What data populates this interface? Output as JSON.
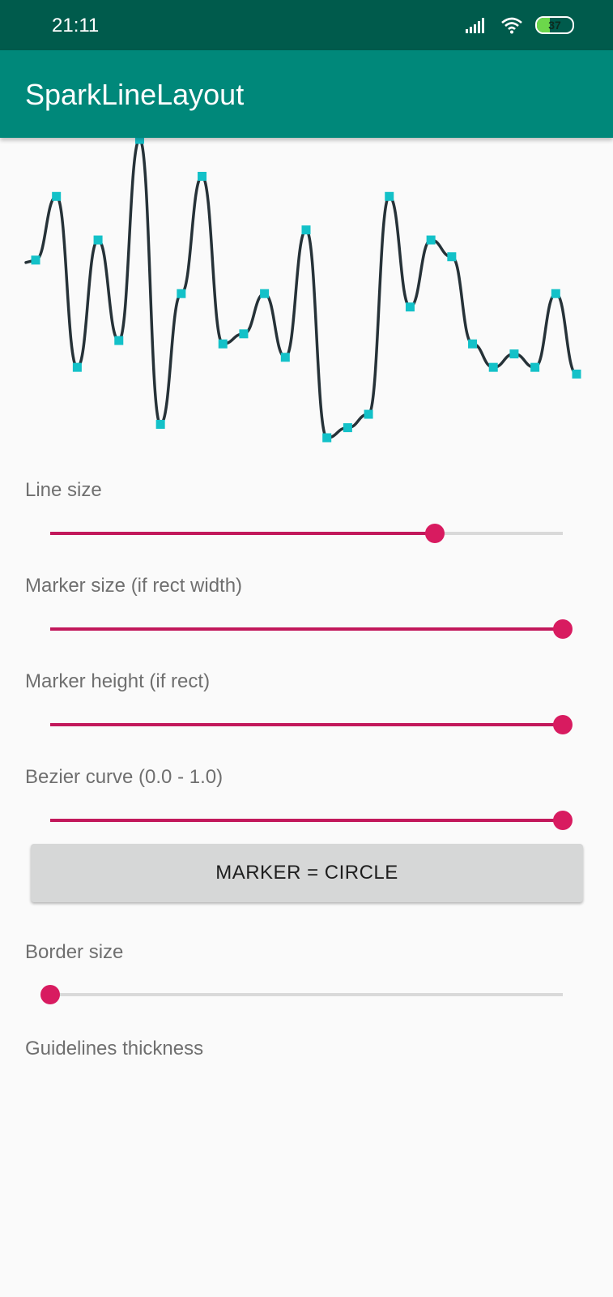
{
  "status_bar": {
    "time": "21:11",
    "battery_percent": 37,
    "icons": [
      "signal-icon",
      "wifi-icon",
      "battery-icon"
    ]
  },
  "app_bar": {
    "title": "SparkLineLayout"
  },
  "colors": {
    "status_bar": "#005b4c",
    "app_bar": "#00887a",
    "line": "#263238",
    "marker": "#13c1c8",
    "slider_accent": "#d81b60",
    "slider_track": "#d9d9d9",
    "button_bg": "#d6d7d7"
  },
  "chart_data": {
    "type": "line",
    "values": [
      4.4,
      6.3,
      1.2,
      5.0,
      2.0,
      8.0,
      -0.5,
      3.4,
      6.9,
      1.9,
      2.2,
      3.4,
      1.5,
      5.3,
      -0.9,
      -0.6,
      -0.2,
      6.3,
      3.0,
      5.0,
      4.5,
      1.9,
      1.2,
      1.6,
      1.2,
      3.4,
      1.0
    ],
    "marker_shape": "rect",
    "curve": "bezier"
  },
  "controls": {
    "line_size": {
      "label": "Line size",
      "value": 0.75
    },
    "marker_size": {
      "label": "Marker size (if rect width)",
      "value": 1.0
    },
    "marker_height": {
      "label": "Marker height (if rect)",
      "value": 1.0
    },
    "bezier_curve": {
      "label": "Bezier curve (0.0 - 1.0)",
      "value": 1.0
    },
    "marker_button": {
      "label": "MARKER = CIRCLE"
    },
    "border_size": {
      "label": "Border size",
      "value": 0.0
    },
    "guidelines_thickness": {
      "label": "Guidelines thickness"
    }
  }
}
